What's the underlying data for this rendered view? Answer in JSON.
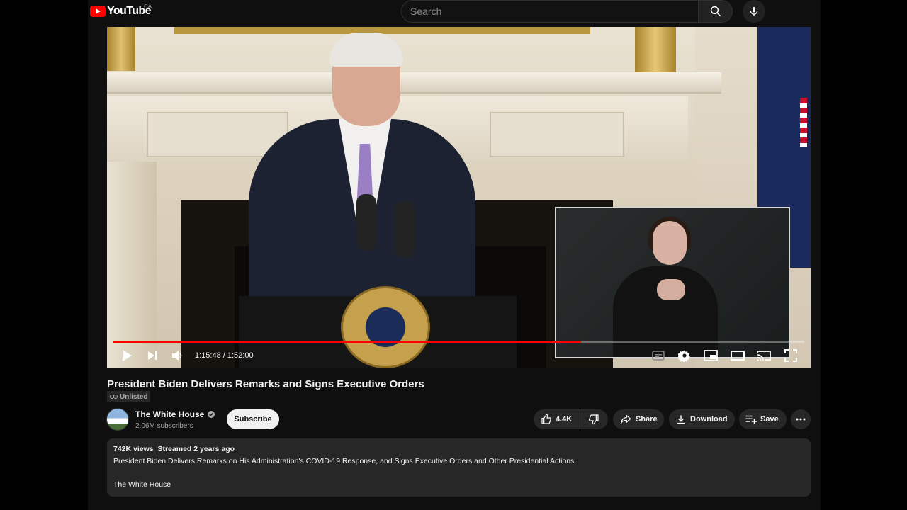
{
  "header": {
    "logo_text": "YouTube",
    "country_code": "CA",
    "search_placeholder": "Search"
  },
  "player": {
    "current_time": "1:15:48",
    "duration": "1:52:00",
    "time_display": "1:15:48 / 1:52:00",
    "progress_fraction": 0.677,
    "colors": {
      "progress": "#ff0000"
    }
  },
  "video": {
    "title": "President Biden Delivers Remarks and Signs Executive Orders",
    "visibility": "Unlisted"
  },
  "channel": {
    "name": "The White House",
    "subscribers": "2.06M subscribers",
    "verified": true,
    "subscribe_label": "Subscribe"
  },
  "actions": {
    "like_count": "4.4K",
    "share_label": "Share",
    "download_label": "Download",
    "save_label": "Save"
  },
  "description": {
    "views": "742K views",
    "streamed": "Streamed 2 years ago",
    "text": "President Biden Delivers Remarks on His Administration's COVID-19 Response, and Signs Executive Orders and Other Presidential Actions",
    "signature": "The White House"
  },
  "icons": [
    "youtube-logo-icon",
    "search-icon",
    "mic-icon",
    "play-icon",
    "next-icon",
    "volume-icon",
    "captions-icon",
    "settings-icon",
    "miniplayer-icon",
    "theater-icon",
    "cast-icon",
    "fullscreen-icon",
    "link-icon",
    "verified-icon",
    "like-icon",
    "dislike-icon",
    "share-icon",
    "download-icon",
    "save-icon",
    "more-icon"
  ]
}
